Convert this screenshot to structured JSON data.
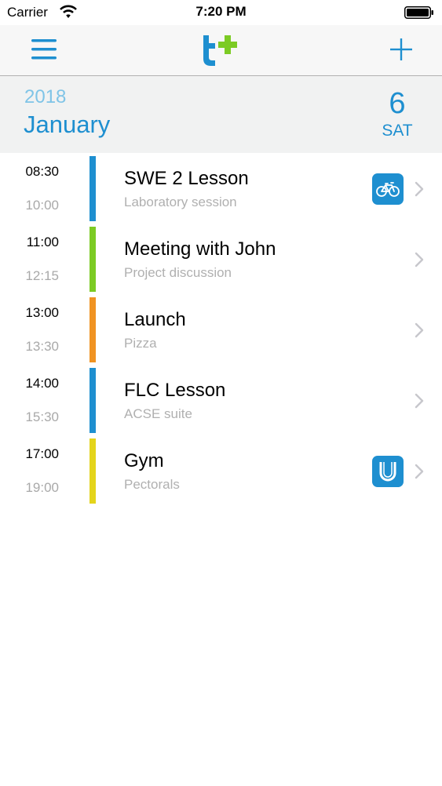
{
  "status_bar": {
    "carrier": "Carrier",
    "time": "7:20 PM",
    "icons": [
      "wifi-icon",
      "battery-icon"
    ]
  },
  "nav_bar": {
    "left_icon": "menu-icon",
    "logo_icon": "app-logo-icon",
    "right_icon": "plus-icon",
    "logo_colors": {
      "letter": "#1e8fd0",
      "plus": "#7ccb24"
    }
  },
  "date_header": {
    "year": "2018",
    "month": "January",
    "day_number": "6",
    "day_name": "SAT"
  },
  "colors": {
    "accent": "#1e8fd0",
    "year_text": "#7fc4e7",
    "header_bg": "#f1f2f2",
    "secondary_text": "#b0b0b0"
  },
  "events": [
    {
      "start": "08:30",
      "end": "10:00",
      "title": "SWE 2 Lesson",
      "subtitle": "Laboratory session",
      "color": "#1e8fd0",
      "badge_icon": "bicycle-icon"
    },
    {
      "start": "11:00",
      "end": "12:15",
      "title": "Meeting with John",
      "subtitle": "Project discussion",
      "color": "#7ccb24",
      "badge_icon": ""
    },
    {
      "start": "13:00",
      "end": "13:30",
      "title": "Launch",
      "subtitle": "Pizza",
      "color": "#f09322",
      "badge_icon": ""
    },
    {
      "start": "14:00",
      "end": "15:30",
      "title": "FLC Lesson",
      "subtitle": "ACSE suite",
      "color": "#1e8fd0",
      "badge_icon": ""
    },
    {
      "start": "17:00",
      "end": "19:00",
      "title": "Gym",
      "subtitle": "Pectorals",
      "color": "#e4d41b",
      "badge_icon": "horseshoe-icon"
    }
  ]
}
